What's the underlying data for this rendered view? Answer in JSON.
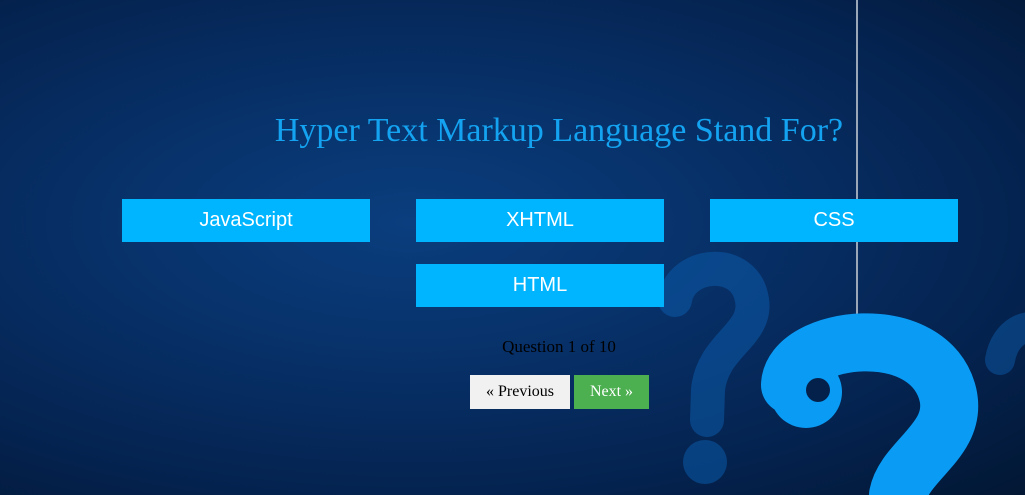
{
  "quiz": {
    "question": "Hyper Text Markup Language Stand For?",
    "options": [
      {
        "label": "JavaScript"
      },
      {
        "label": "XHTML"
      },
      {
        "label": "CSS"
      },
      {
        "label": "HTML"
      }
    ],
    "counter": "Question 1 of 10",
    "previous_label": "« Previous",
    "next_label": "Next »"
  },
  "colors": {
    "background": "#062a5c",
    "title": "#14a3f0",
    "option_bg": "#00b5ff",
    "option_text": "#ffffff",
    "previous_bg": "#f1f1f1",
    "next_bg": "#4caf50",
    "question_mark_bright": "#0a9cf5",
    "question_mark_faint": "#0b4f9a"
  },
  "decorations": {
    "icons": [
      "question-mark-icon",
      "hanging-string-icon"
    ]
  }
}
